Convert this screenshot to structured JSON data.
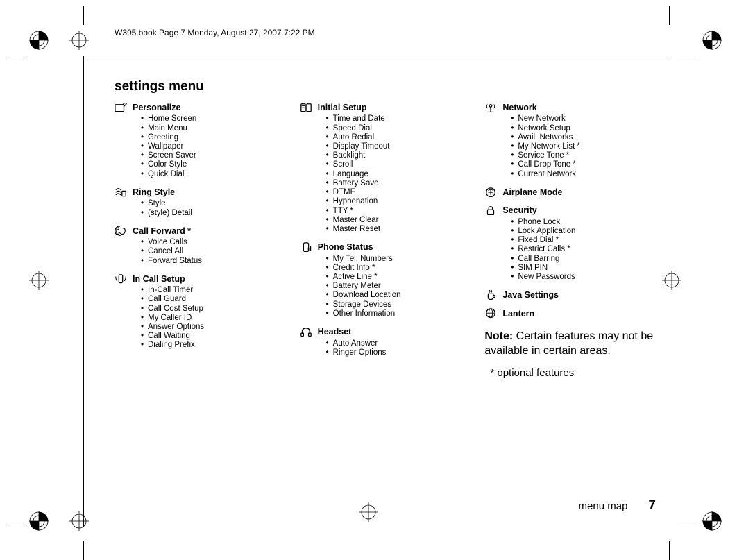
{
  "header": "W395.book  Page 7  Monday, August 27, 2007  7:22 PM",
  "title": "settings menu",
  "col1": [
    {
      "heading": "Personalize",
      "icon": "personalize-icon",
      "items": [
        "Home Screen",
        "Main Menu",
        "Greeting",
        "Wallpaper",
        "Screen Saver",
        "Color Style",
        "Quick Dial"
      ]
    },
    {
      "heading": "Ring Style",
      "icon": "ring-style-icon",
      "items": [
        "Style",
        "(style) Detail"
      ]
    },
    {
      "heading": "Call Forward *",
      "icon": "call-forward-icon",
      "items": [
        "Voice Calls",
        "Cancel All",
        "Forward Status"
      ]
    },
    {
      "heading": "In Call Setup",
      "icon": "in-call-setup-icon",
      "items": [
        "In-Call Timer",
        "Call Guard",
        "Call Cost Setup",
        "My Caller ID",
        "Answer Options",
        "Call Waiting",
        "Dialing Prefix"
      ]
    }
  ],
  "col2": [
    {
      "heading": "Initial Setup",
      "icon": "initial-setup-icon",
      "items": [
        "Time and Date",
        "Speed Dial",
        "Auto Redial",
        "Display Timeout",
        "Backlight",
        "Scroll",
        "Language",
        "Battery Save",
        "DTMF",
        "Hyphenation",
        "TTY *",
        "Master Clear",
        "Master Reset"
      ]
    },
    {
      "heading": "Phone Status",
      "icon": "phone-status-icon",
      "items": [
        "My Tel. Numbers",
        "Credit Info *",
        "Active Line *",
        "Battery Meter",
        "Download Location",
        "Storage Devices",
        "Other Information"
      ]
    },
    {
      "heading": "Headset",
      "icon": "headset-icon",
      "items": [
        "Auto Answer",
        "Ringer Options"
      ]
    }
  ],
  "col3": [
    {
      "heading": "Network",
      "icon": "network-icon",
      "items": [
        "New Network",
        "Network Setup",
        "Avail. Networks",
        "My Network List *",
        "Service Tone *",
        "Call Drop Tone *",
        "Current Network"
      ]
    },
    {
      "heading": "Airplane Mode",
      "icon": "airplane-mode-icon",
      "items": []
    },
    {
      "heading": "Security",
      "icon": "security-icon",
      "items": [
        "Phone Lock",
        "Lock Application",
        "Fixed Dial *",
        "Restrict Calls *",
        "Call Barring",
        "SIM PIN",
        "New Passwords"
      ]
    },
    {
      "heading": "Java Settings",
      "icon": "java-settings-icon",
      "items": []
    },
    {
      "heading": "Lantern",
      "icon": "lantern-icon",
      "items": []
    }
  ],
  "note_label": "Note:",
  "note_text": " Certain features may not be available in certain areas.",
  "optional_text": "* optional features",
  "footer_label": "menu map",
  "footer_page": "7"
}
